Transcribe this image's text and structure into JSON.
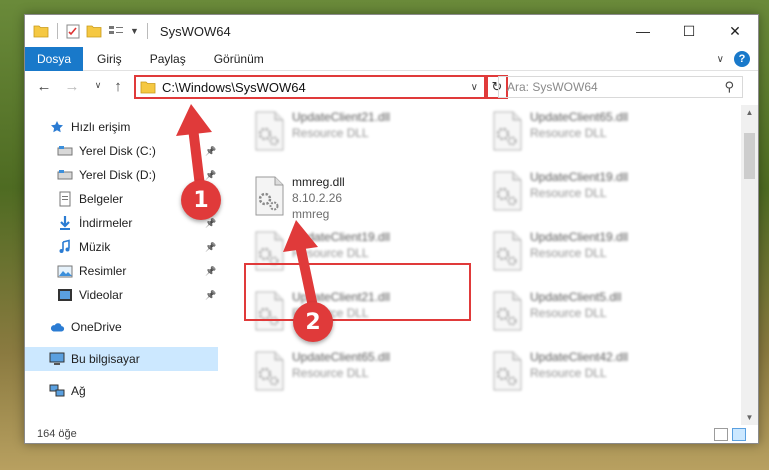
{
  "window": {
    "title": "SysWOW64",
    "controls": {
      "minimize": "—",
      "maximize": "☐",
      "close": "✕"
    }
  },
  "ribbon": {
    "tabs": [
      "Dosya",
      "Giriş",
      "Paylaş",
      "Görünüm"
    ],
    "help": "?"
  },
  "address": {
    "path": "C:\\Windows\\SysWOW64",
    "search_placeholder": "Ara: SysWOW64"
  },
  "sidebar": {
    "items": [
      {
        "label": "Hızlı erişim",
        "icon": "star-icon"
      },
      {
        "label": "Yerel Disk (C:)",
        "icon": "drive-icon",
        "pinned": true
      },
      {
        "label": "Yerel Disk (D:)",
        "icon": "drive-icon",
        "pinned": true
      },
      {
        "label": "Belgeler",
        "icon": "documents-icon",
        "pinned": true
      },
      {
        "label": "İndirmeler",
        "icon": "download-icon",
        "pinned": true
      },
      {
        "label": "Müzik",
        "icon": "music-icon",
        "pinned": true
      },
      {
        "label": "Resimler",
        "icon": "pictures-icon",
        "pinned": true
      },
      {
        "label": "Videolar",
        "icon": "videos-icon",
        "pinned": true
      },
      {
        "label": "OneDrive",
        "icon": "cloud-icon"
      },
      {
        "label": "Bu bilgisayar",
        "icon": "computer-icon",
        "selected": true
      },
      {
        "label": "Ağ",
        "icon": "network-icon"
      }
    ]
  },
  "files": {
    "left": [
      {
        "name": "UpdateClient21.dll",
        "desc": "Resource DLL"
      },
      {
        "name": "mmreg.dll",
        "desc": "8.10.2.26",
        "desc2": "mmreg"
      },
      {
        "name": "UpdateClient19.dll",
        "desc": "Resource DLL"
      },
      {
        "name": "UpdateClient21.dll",
        "desc": "Resource DLL"
      },
      {
        "name": "UpdateClient65.dll",
        "desc": "Resource DLL"
      }
    ],
    "right": [
      {
        "name": "UpdateClient65.dll",
        "desc": "Resource DLL"
      },
      {
        "name": "UpdateClient19.dll",
        "desc": "Resource DLL"
      },
      {
        "name": "UpdateClient19.dll",
        "desc": "Resource DLL"
      },
      {
        "name": "UpdateClient5.dll",
        "desc": "Resource DLL"
      },
      {
        "name": "UpdateClient42.dll",
        "desc": "Resource DLL"
      }
    ]
  },
  "status": {
    "count": "164 öğe"
  },
  "annotations": {
    "step1": "1",
    "step2": "2",
    "color": "#e03a3a"
  }
}
